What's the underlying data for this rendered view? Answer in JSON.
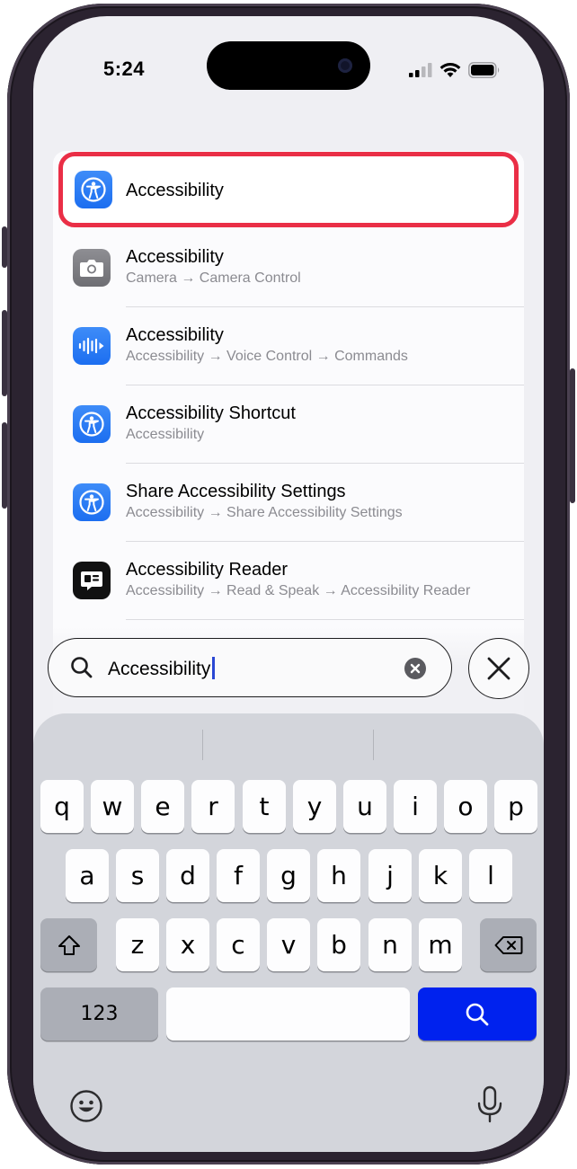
{
  "status_bar": {
    "time": "5:24"
  },
  "results": [
    {
      "title": "Accessibility",
      "subtitle": "",
      "icon": "accessibility-icon",
      "highlighted": true
    },
    {
      "title": "Accessibility",
      "subtitle": "Camera → Camera Control",
      "icon": "camera-icon"
    },
    {
      "title": "Accessibility",
      "subtitle": "Accessibility → Voice Control → Commands",
      "icon": "voice-control-icon"
    },
    {
      "title": "Accessibility Shortcut",
      "subtitle": "Accessibility",
      "icon": "accessibility-icon"
    },
    {
      "title": "Share Accessibility Settings",
      "subtitle": "Accessibility → Share Accessibility Settings",
      "icon": "accessibility-icon"
    },
    {
      "title": "Accessibility Reader",
      "subtitle": "Accessibility → Read & Speak → Accessibility Reader",
      "icon": "reader-icon"
    }
  ],
  "search": {
    "query": "Accessibility"
  },
  "keyboard": {
    "row1": [
      "q",
      "w",
      "e",
      "r",
      "t",
      "y",
      "u",
      "i",
      "o",
      "p"
    ],
    "row2": [
      "a",
      "s",
      "d",
      "f",
      "g",
      "h",
      "j",
      "k",
      "l"
    ],
    "row3": [
      "z",
      "x",
      "c",
      "v",
      "b",
      "n",
      "m"
    ],
    "numbers_label": "123"
  },
  "colors": {
    "highlight": "#ea2e46",
    "search_key": "#0022ee",
    "icon_blue": "#1c6ef0"
  }
}
